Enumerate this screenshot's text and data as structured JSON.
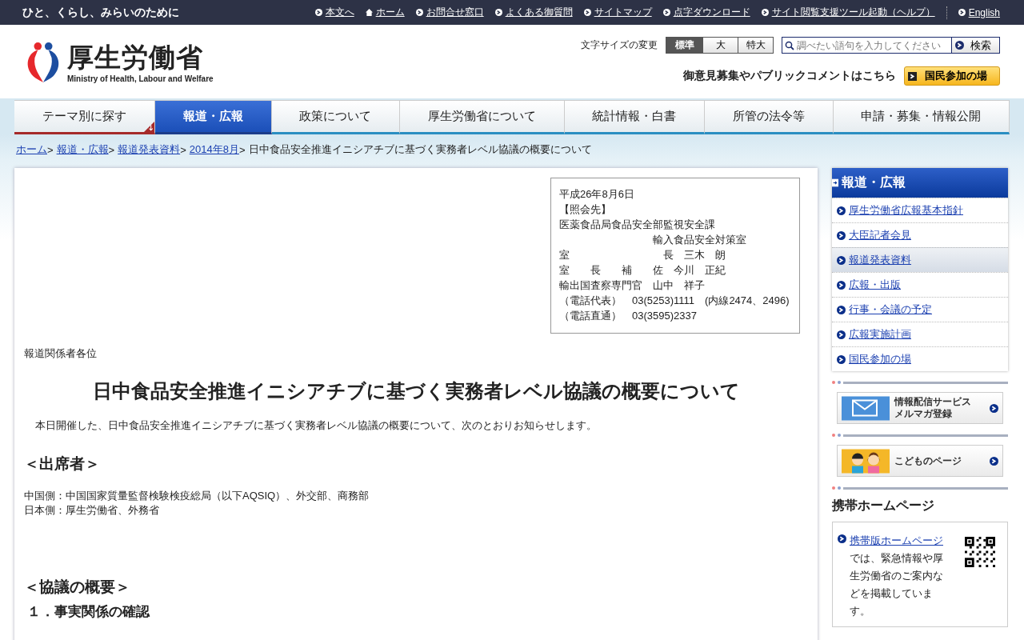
{
  "top_bar": {
    "tagline": "ひと、くらし、みらいのために",
    "links": [
      {
        "label": "本文へ",
        "kind": "arrow"
      },
      {
        "label": "ホーム",
        "kind": "home"
      },
      {
        "label": "お問合せ窓口",
        "kind": "arrow"
      },
      {
        "label": "よくある御質問",
        "kind": "arrow"
      },
      {
        "label": "サイトマップ",
        "kind": "arrow"
      },
      {
        "label": "点字ダウンロード",
        "kind": "arrow"
      },
      {
        "label": "サイト閲覧支援ツール起動（ヘルプ）",
        "kind": "arrow"
      }
    ],
    "language_link": "English"
  },
  "header": {
    "logo": {
      "title": "厚生労働省",
      "subtitle": "Ministry of Health, Labour and Welfare"
    },
    "font_size": {
      "label": "文字サイズの変更",
      "options": [
        {
          "label": "標準",
          "selected": true
        },
        {
          "label": "大",
          "selected": false
        },
        {
          "label": "特大",
          "selected": false
        }
      ]
    },
    "search": {
      "placeholder": "調べたい語句を入力してください",
      "button": "検索"
    },
    "public_comment": {
      "text": "御意見募集やパブリックコメントはこちら",
      "button": "国民参加の場"
    }
  },
  "nav": [
    {
      "label": "テーマ別に探す",
      "selected": false,
      "kind": "dropdown"
    },
    {
      "label": "報道・広報",
      "selected": true,
      "kind": "link"
    },
    {
      "label": "政策について",
      "selected": false,
      "kind": "link"
    },
    {
      "label": "厚生労働省について",
      "selected": false,
      "kind": "link"
    },
    {
      "label": "統計情報・白書",
      "selected": false,
      "kind": "link"
    },
    {
      "label": "所管の法令等",
      "selected": false,
      "kind": "link"
    },
    {
      "label": "申請・募集・情報公開",
      "selected": false,
      "kind": "link"
    }
  ],
  "breadcrumb": {
    "separator": ">",
    "links": [
      "ホーム",
      "報道・広報",
      "報道発表資料",
      "2014年8月"
    ],
    "current": "日中食品安全推進イニシアチブに基づく実務者レベル協議の概要について"
  },
  "article": {
    "contact_lines": [
      "平成26年8月6日",
      "【照会先】",
      "医薬食品局食品安全部監視安全課",
      "　　　　　　　　　輸入食品安全対策室",
      "室　　　　　　　　　長　三木　朗",
      "室　　長　　補　　佐　今川　正紀",
      "輸出国査察専門官　山中　祥子",
      "（電話代表）　03(5253)1111　(内線2474、2496)",
      "（電話直通）　03(3595)2337"
    ],
    "addressee": "報道関係者各位",
    "title": "日中食品安全推進イニシアチブに基づく実務者レベル協議の概要について",
    "intro": "本日開催した、日中食品安全推進イニシアチブに基づく実務者レベル協議の概要について、次のとおりお知らせします。",
    "attendees_heading": "＜出席者＞",
    "attendees": [
      "中国側：中国国家質量監督検験検疫総局（以下AQSIQ）、外交部、商務部",
      "日本側：厚生労働省、外務省"
    ],
    "summary_heading": "＜協議の概要＞",
    "subheading": "１．事実関係の確認"
  },
  "sidebar": {
    "section_title": "報道・広報",
    "items": [
      {
        "label": "厚生労働省広報基本指針",
        "selected": false
      },
      {
        "label": "大臣記者会見",
        "selected": false
      },
      {
        "label": "報道発表資料",
        "selected": true
      },
      {
        "label": "広報・出版",
        "selected": false
      },
      {
        "label": "行事・会議の予定",
        "selected": false
      },
      {
        "label": "広報実施計画",
        "selected": false
      },
      {
        "label": "国民参加の場",
        "selected": false
      }
    ],
    "banners": [
      {
        "lines": [
          "情報配信サービス",
          "メルマガ登録"
        ],
        "kind": "mail"
      },
      {
        "lines": [
          "こどものページ"
        ],
        "kind": "kids"
      }
    ],
    "mobile": {
      "heading": "携帯ホームページ",
      "link": "携帯版ホームページ",
      "text": "では、緊急情報や厚生労働省のご案内などを掲載しています。"
    }
  }
}
